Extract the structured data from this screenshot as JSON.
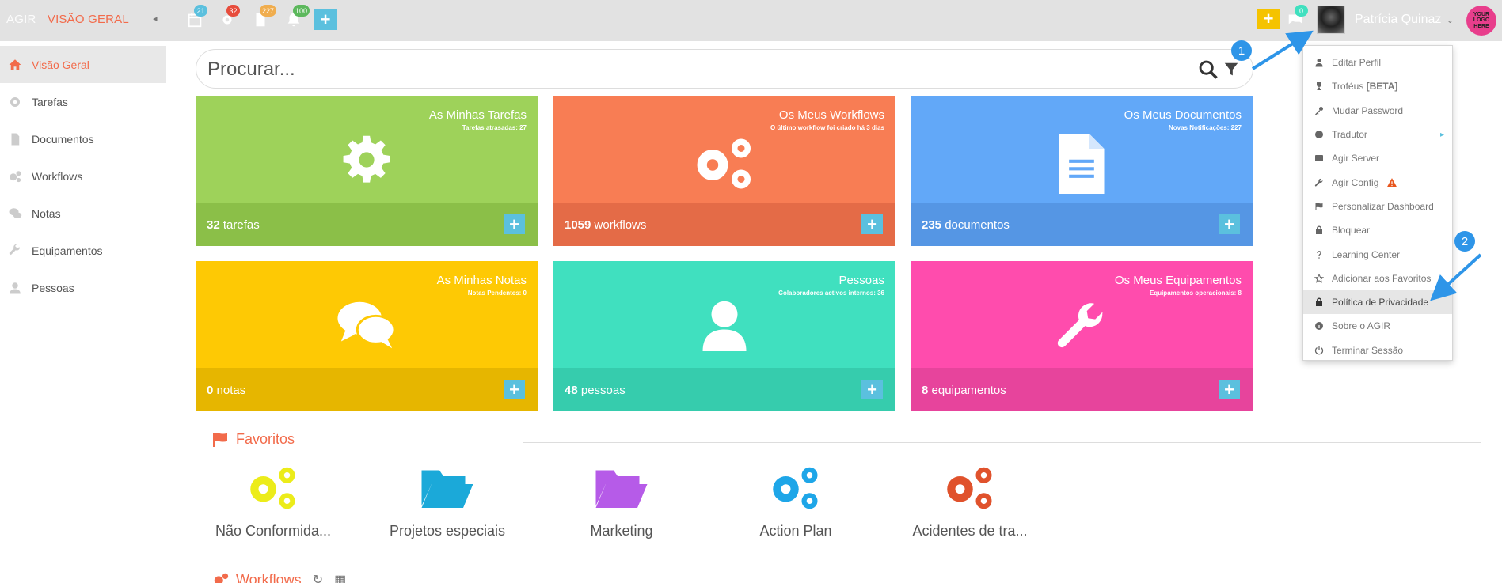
{
  "topbar": {
    "app_name": "AGIR",
    "section": "VISÃO GERAL",
    "collapse_glyph": "◂",
    "icons": [
      {
        "name": "calendar-icon",
        "badge": "21",
        "badge_color": "#5bc0de"
      },
      {
        "name": "gear-icon",
        "badge": "32",
        "badge_color": "#e74c3c"
      },
      {
        "name": "document-icon",
        "badge": "227",
        "badge_color": "#f0ad4e"
      },
      {
        "name": "bell-icon",
        "badge": "100",
        "badge_color": "#5cb85c"
      }
    ],
    "add_glyph": "+",
    "quick_add_glyph": "+",
    "chat_badge": "0",
    "user_name": "Patrícia Quinaz",
    "caret": "⌄",
    "logo_text": "YOUR LOGO HERE",
    "colors": {
      "accent": "#f26b4b",
      "add_blue": "#5bc0de",
      "add_yellow": "#f5c300"
    }
  },
  "sidebar": {
    "items": [
      {
        "label": "Visão Geral",
        "icon": "home-icon",
        "active": true
      },
      {
        "label": "Tarefas",
        "icon": "gear-icon"
      },
      {
        "label": "Documentos",
        "icon": "document-icon"
      },
      {
        "label": "Workflows",
        "icon": "gears-icon"
      },
      {
        "label": "Notas",
        "icon": "comments-icon"
      },
      {
        "label": "Equipamentos",
        "icon": "wrench-icon"
      },
      {
        "label": "Pessoas",
        "icon": "user-icon"
      }
    ]
  },
  "search": {
    "placeholder": "Procurar..."
  },
  "tiles": [
    {
      "title": "As Minhas Tarefas",
      "subtitle": "Tarefas atrasadas: 27",
      "count": "32",
      "unit": "tarefas",
      "icon": "gear-icon",
      "color": "#9ed25a",
      "foot_color": "#8bbf48"
    },
    {
      "title": "Os Meus Workflows",
      "subtitle": "O último workflow foi criado há 3 dias",
      "count": "1059",
      "unit": "workflows",
      "icon": "gears-icon",
      "color": "#f87d54",
      "foot_color": "#e46b47"
    },
    {
      "title": "Os Meus Documentos",
      "subtitle": "Novas Notificações: 227",
      "count": "235",
      "unit": "documentos",
      "icon": "document-icon",
      "color": "#62a8f8",
      "foot_color": "#5596e4"
    },
    {
      "title": "As Minhas Notas",
      "subtitle": "Notas Pendentes: 0",
      "count": "0",
      "unit": "notas",
      "icon": "comments-icon",
      "color": "#fec904",
      "foot_color": "#e6b600"
    },
    {
      "title": "Pessoas",
      "subtitle": "Colaboradores activos internos: 36",
      "count": "48",
      "unit": "pessoas",
      "icon": "user-icon",
      "color": "#40e0bf",
      "foot_color": "#36ccad"
    },
    {
      "title": "Os Meus Equipamentos",
      "subtitle": "Equipamentos operacionais: 8",
      "count": "8",
      "unit": "equipamentos",
      "icon": "wrench-icon",
      "color": "#ff4cad",
      "foot_color": "#e7449c"
    }
  ],
  "tile_add_glyph": "+",
  "favorites": {
    "title": "Favoritos",
    "items": [
      {
        "label": "Não Conformida...",
        "icon": "gears-icon",
        "color": "#ecec1a"
      },
      {
        "label": "Projetos especiais",
        "icon": "folder-open-icon",
        "color": "#1ba9d9"
      },
      {
        "label": "Marketing",
        "icon": "folder-open-icon",
        "color": "#b65be8"
      },
      {
        "label": "Action Plan",
        "icon": "gears-icon",
        "color": "#1ea6e8"
      },
      {
        "label": "Acidentes de tra...",
        "icon": "gears-icon",
        "color": "#e0522c"
      }
    ]
  },
  "workflows_section": {
    "title": "Workflows",
    "refresh_glyph": "↻",
    "grid_glyph": "▦"
  },
  "user_menu": {
    "items": [
      {
        "label": "Editar Perfil",
        "icon": "user-icon"
      },
      {
        "label": "Troféus",
        "suffix": "[BETA]",
        "icon": "trophy-icon"
      },
      {
        "label": "Mudar Password",
        "icon": "key-icon"
      },
      {
        "label": "Tradutor",
        "icon": "globe-icon",
        "submenu": true
      },
      {
        "label": "Agir Server",
        "icon": "server-icon"
      },
      {
        "label": "Agir Config",
        "icon": "wrench-icon",
        "warning": true
      },
      {
        "label": "Personalizar Dashboard",
        "icon": "flag-icon"
      },
      {
        "label": "Bloquear",
        "icon": "lock-icon"
      },
      {
        "label": "Learning Center",
        "icon": "question-icon"
      },
      {
        "label": "Adicionar aos Favoritos",
        "icon": "star-icon"
      },
      {
        "label": "Política de Privacidade",
        "icon": "lock-icon",
        "active": true
      },
      {
        "label": "Sobre o AGIR",
        "icon": "info-icon"
      },
      {
        "label": "Terminar Sessão",
        "icon": "power-icon"
      }
    ],
    "submenu_glyph": "▸"
  },
  "annotations": [
    {
      "label": "1"
    },
    {
      "label": "2"
    }
  ]
}
